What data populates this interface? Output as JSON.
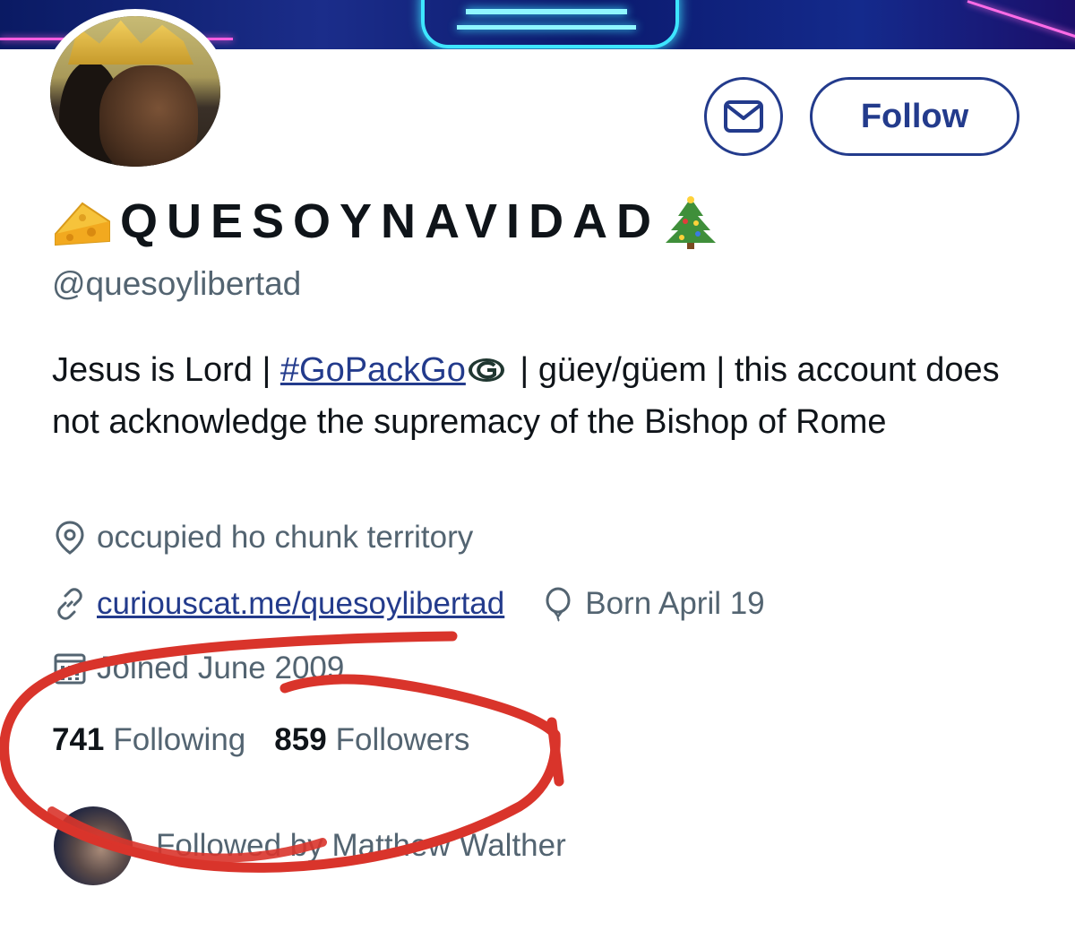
{
  "profile": {
    "display_name": "QUESOYNAVIDAD",
    "emoji_left": "cheese-emoji",
    "emoji_right": "christmas-tree-emoji",
    "handle": "@quesoylibertad",
    "bio": {
      "part1": "Jesus is Lord | ",
      "hashtag": "#GoPackGo",
      "part2": " | güey/güem | this account does not acknowledge the supremacy of the Bishop of Rome"
    },
    "location": "occupied ho chunk territory",
    "website": "curiouscat.me/quesoylibertad",
    "birthday": "Born April 19",
    "joined": "Joined June 2009",
    "following_count": "741",
    "following_label": "Following",
    "followers_count": "859",
    "followers_label": "Followers",
    "followed_by": "Followed by Matthew Walther"
  },
  "actions": {
    "follow_label": "Follow",
    "message_icon": "mail-icon"
  },
  "icons": {
    "location": "location-pin-icon",
    "link": "link-icon",
    "birthday": "balloon-icon",
    "joined": "calendar-icon"
  },
  "colors": {
    "accent": "#233b8c",
    "secondary_text": "#536471",
    "annotation": "#d9342b",
    "banner": "#0b1a6e"
  }
}
